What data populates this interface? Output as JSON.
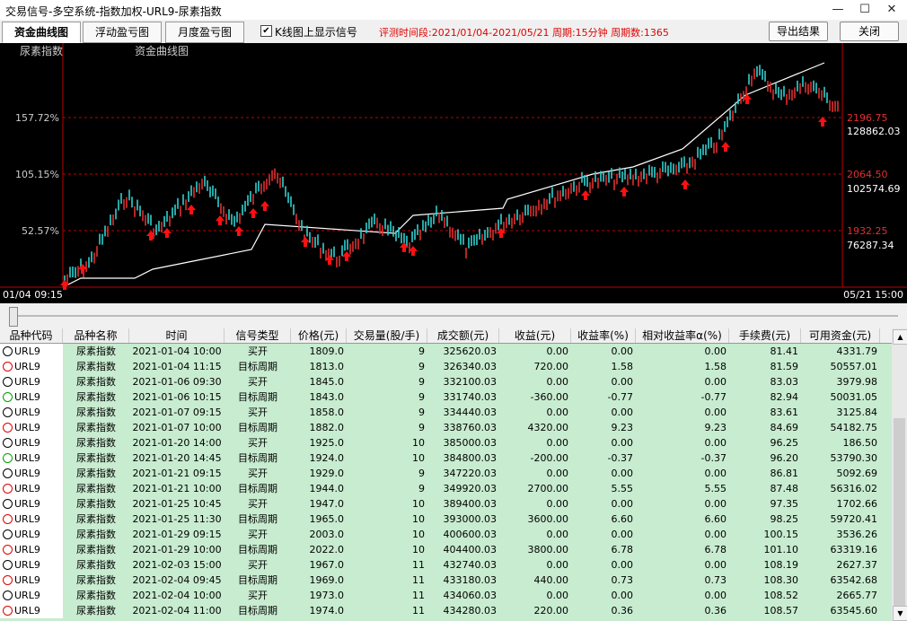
{
  "window": {
    "title": "交易信号-多空系统-指数加权-URL9-尿素指数"
  },
  "tabs": [
    {
      "label": "资金曲线图",
      "active": true
    },
    {
      "label": "浮动盈亏图",
      "active": false
    },
    {
      "label": "月度盈亏图",
      "active": false
    }
  ],
  "checkbox": {
    "label": "K线图上显示信号",
    "checked": "✔"
  },
  "info": {
    "text": "评测时间段:2021/01/04-2021/05/21  周期:15分钟  周期数:1365"
  },
  "buttons": {
    "export": "导出结果",
    "close": "关闭"
  },
  "chart": {
    "name_left": "尿素指数",
    "name_center": "资金曲线图",
    "left_ticks": [
      "157.72%",
      "105.15%",
      "52.57%"
    ],
    "right_prices": [
      "2196.75",
      "2064.50",
      "1932.25"
    ],
    "right_capital": [
      "128862.03",
      "102574.69",
      "76287.34"
    ],
    "start_time": "01/04 09:15",
    "end_time": "05/21 15:00"
  },
  "table": {
    "headers": [
      "品种代码",
      "品种名称",
      "时间",
      "信号类型",
      "价格(元)",
      "交易量(股/手)",
      "成交额(元)",
      "收益(元)",
      "收益率(%)",
      "相对收益率α(%)",
      "手续费(元)",
      "可用资金(元)"
    ],
    "rows": [
      [
        "URL9",
        "尿素指数",
        "2021-01-04 10:00",
        "买开",
        "1809.0",
        "9",
        "325620.03",
        "0.00",
        "0.00",
        "0.00",
        "81.41",
        "4331.79"
      ],
      [
        "URL9",
        "尿素指数",
        "2021-01-04 11:15",
        "目标周期",
        "1813.0",
        "9",
        "326340.03",
        "720.00",
        "1.58",
        "1.58",
        "81.59",
        "50557.01"
      ],
      [
        "URL9",
        "尿素指数",
        "2021-01-06 09:30",
        "买开",
        "1845.0",
        "9",
        "332100.03",
        "0.00",
        "0.00",
        "0.00",
        "83.03",
        "3979.98"
      ],
      [
        "URL9",
        "尿素指数",
        "2021-01-06 10:15",
        "目标周期",
        "1843.0",
        "9",
        "331740.03",
        "-360.00",
        "-0.77",
        "-0.77",
        "82.94",
        "50031.05"
      ],
      [
        "URL9",
        "尿素指数",
        "2021-01-07 09:15",
        "买开",
        "1858.0",
        "9",
        "334440.03",
        "0.00",
        "0.00",
        "0.00",
        "83.61",
        "3125.84"
      ],
      [
        "URL9",
        "尿素指数",
        "2021-01-07 10:00",
        "目标周期",
        "1882.0",
        "9",
        "338760.03",
        "4320.00",
        "9.23",
        "9.23",
        "84.69",
        "54182.75"
      ],
      [
        "URL9",
        "尿素指数",
        "2021-01-20 14:00",
        "买开",
        "1925.0",
        "10",
        "385000.03",
        "0.00",
        "0.00",
        "0.00",
        "96.25",
        "186.50"
      ],
      [
        "URL9",
        "尿素指数",
        "2021-01-20 14:45",
        "目标周期",
        "1924.0",
        "10",
        "384800.03",
        "-200.00",
        "-0.37",
        "-0.37",
        "96.20",
        "53790.30"
      ],
      [
        "URL9",
        "尿素指数",
        "2021-01-21 09:15",
        "买开",
        "1929.0",
        "9",
        "347220.03",
        "0.00",
        "0.00",
        "0.00",
        "86.81",
        "5092.69"
      ],
      [
        "URL9",
        "尿素指数",
        "2021-01-21 10:00",
        "目标周期",
        "1944.0",
        "9",
        "349920.03",
        "2700.00",
        "5.55",
        "5.55",
        "87.48",
        "56316.02"
      ],
      [
        "URL9",
        "尿素指数",
        "2021-01-25 10:45",
        "买开",
        "1947.0",
        "10",
        "389400.03",
        "0.00",
        "0.00",
        "0.00",
        "97.35",
        "1702.66"
      ],
      [
        "URL9",
        "尿素指数",
        "2021-01-25 11:30",
        "目标周期",
        "1965.0",
        "10",
        "393000.03",
        "3600.00",
        "6.60",
        "6.60",
        "98.25",
        "59720.41"
      ],
      [
        "URL9",
        "尿素指数",
        "2021-01-29 09:15",
        "买开",
        "2003.0",
        "10",
        "400600.03",
        "0.00",
        "0.00",
        "0.00",
        "100.15",
        "3536.26"
      ],
      [
        "URL9",
        "尿素指数",
        "2021-01-29 10:00",
        "目标周期",
        "2022.0",
        "10",
        "404400.03",
        "3800.00",
        "6.78",
        "6.78",
        "101.10",
        "63319.16"
      ],
      [
        "URL9",
        "尿素指数",
        "2021-02-03 15:00",
        "买开",
        "1967.0",
        "11",
        "432740.03",
        "0.00",
        "0.00",
        "0.00",
        "108.19",
        "2627.37"
      ],
      [
        "URL9",
        "尿素指数",
        "2021-02-04 09:45",
        "目标周期",
        "1969.0",
        "11",
        "433180.03",
        "440.00",
        "0.73",
        "0.73",
        "108.30",
        "63542.68"
      ],
      [
        "URL9",
        "尿素指数",
        "2021-02-04 10:00",
        "买开",
        "1973.0",
        "11",
        "434060.03",
        "0.00",
        "0.00",
        "0.00",
        "108.52",
        "2665.77"
      ],
      [
        "URL9",
        "尿素指数",
        "2021-02-04 11:00",
        "目标周期",
        "1974.0",
        "11",
        "434280.03",
        "220.00",
        "0.36",
        "0.36",
        "108.57",
        "63545.60"
      ]
    ],
    "row_icons": [
      "black",
      "red",
      "black",
      "green",
      "black",
      "red",
      "black",
      "green",
      "black",
      "red",
      "black",
      "red",
      "black",
      "red",
      "black",
      "red",
      "black",
      "red"
    ]
  },
  "colors": {
    "accent_red": "#e00000",
    "row_bg": "#c8ecd0",
    "chart_bg": "#000000"
  }
}
